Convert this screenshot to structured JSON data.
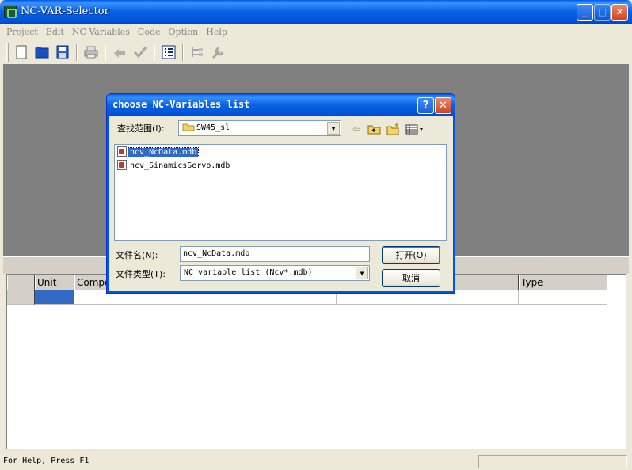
{
  "window": {
    "title": "NC-VAR-Selector"
  },
  "menu": [
    {
      "label": "Project",
      "accel": "P"
    },
    {
      "label": "Edit",
      "accel": "E"
    },
    {
      "label": "NC Variables",
      "accel": "N"
    },
    {
      "label": "Code",
      "accel": "C"
    },
    {
      "label": "Option",
      "accel": "O"
    },
    {
      "label": "Help",
      "accel": "H"
    }
  ],
  "grid": {
    "columns": [
      "",
      "Unit",
      "Compo",
      "",
      "Type"
    ]
  },
  "status": {
    "text": "For Help, Press F1"
  },
  "dialog": {
    "title": "choose NC-Variables list",
    "help_label": "?",
    "close_label": "✕",
    "look_in_label": "查找范围(I):",
    "look_in_value": "SW45_sl",
    "files": [
      "ncv_NcData.mdb",
      "ncv_SinamicsServo.mdb"
    ],
    "selected_file_index": 0,
    "filename_label": "文件名(N):",
    "filename_value": "ncv_NcData.mdb",
    "filetype_label": "文件类型(T):",
    "filetype_value": "NC variable list (Ncv*.mdb)",
    "open_label": "打开(O)",
    "cancel_label": "取消"
  }
}
